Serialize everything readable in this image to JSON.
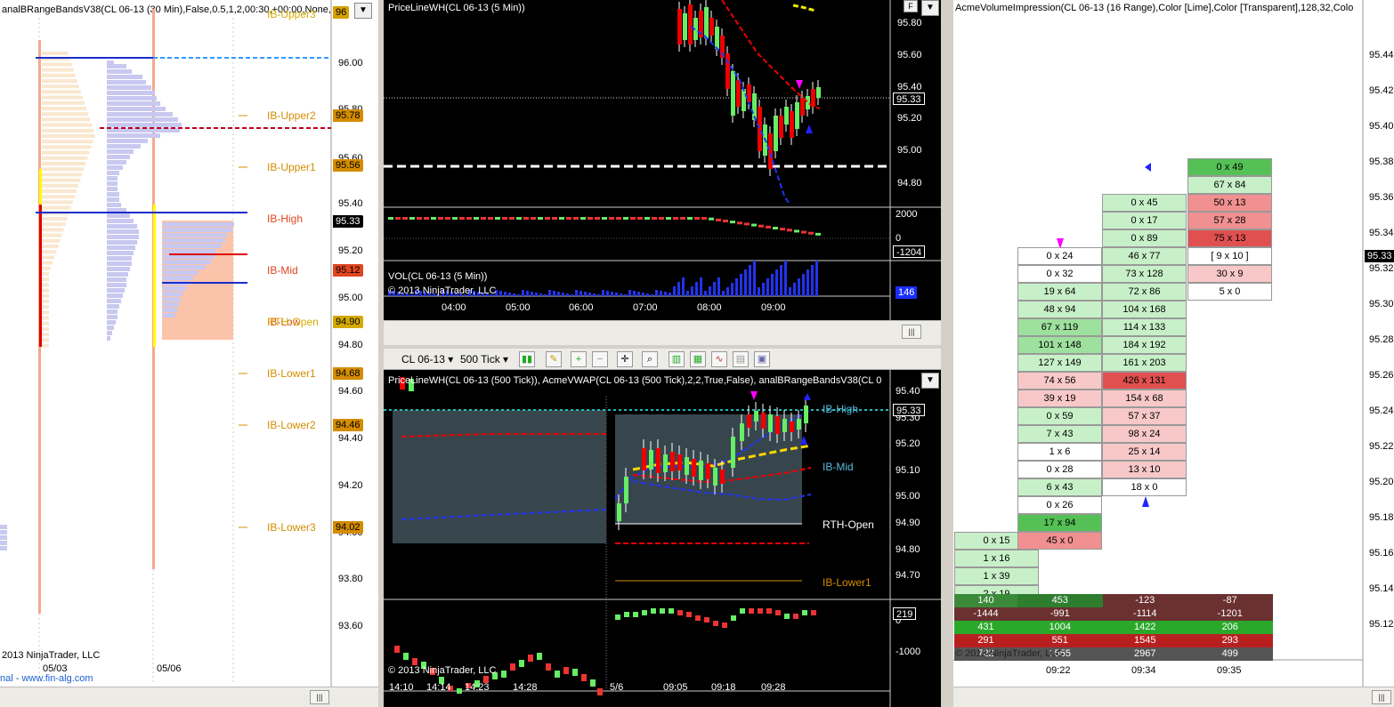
{
  "left_chart": {
    "title": "analBRangeBandsV38(CL 06-13 (30 Min),False,0.5,1,2,00:30,+00:00,None,A",
    "price_labels": [
      "96.00",
      "95.80",
      "95.60",
      "95.40",
      "95.20",
      "95.00",
      "94.80",
      "94.60",
      "94.40",
      "94.20",
      "94.00",
      "93.80",
      "93.60"
    ],
    "levels": [
      {
        "name": "IB-Upper3",
        "color": "#d4aa00"
      },
      {
        "name": "IB-Upper2",
        "color": "#d48c00"
      },
      {
        "name": "IB-Upper1",
        "color": "#d48c00"
      },
      {
        "name": "IB-High",
        "color": "#e0451e"
      },
      {
        "name": "IB-Mid",
        "color": "#e0451e"
      },
      {
        "name": "IB-Low",
        "color": "#e0451e"
      },
      {
        "name": "RTH-Open",
        "color": "#d4aa00"
      },
      {
        "name": "IB-Lower1",
        "color": "#d48c00"
      },
      {
        "name": "IB-Lower2",
        "color": "#d48c00"
      },
      {
        "name": "IB-Lower3",
        "color": "#d48c00"
      }
    ],
    "tags": [
      {
        "value": "96",
        "color": "#d4a000"
      },
      {
        "value": "95.78",
        "color": "#d48c00"
      },
      {
        "value": "95.56",
        "color": "#d48c00"
      },
      {
        "value": "95.33",
        "color": "#000000"
      },
      {
        "value": "95.12",
        "color": "#e0451e"
      },
      {
        "value": "94.90",
        "color": "#d4aa00"
      },
      {
        "value": "94.68",
        "color": "#d48c00"
      },
      {
        "value": "94.46",
        "color": "#d48c00"
      },
      {
        "value": "94.02",
        "color": "#d48c00"
      }
    ],
    "dates": [
      "05/03",
      "05/06"
    ],
    "copyright": "2013 NinjaTrader, LLC",
    "footer_link": "nal - www.fin-alg.com",
    "dd_btn": "▼"
  },
  "top_mid_chart": {
    "title": "PriceLineWH(CL 06-13 (5 Min))",
    "price_labels": [
      "95.80",
      "95.60",
      "95.40",
      "95.20",
      "95.00",
      "94.80"
    ],
    "last_price": "95.33",
    "vol_title": "VOL(CL 06-13 (5 Min))",
    "vol_labels": [
      "2000",
      "0"
    ],
    "vol_tag": "-1204",
    "vol_last": "146",
    "copyright": "© 2013 NinjaTrader, LLC",
    "times": [
      "04:00",
      "05:00",
      "06:00",
      "07:00",
      "08:00",
      "09:00"
    ],
    "f_btn": "F",
    "dd_btn": "▼",
    "scroll_btn": "|||"
  },
  "toolbar": {
    "instrument": "CL 06-13",
    "period": "500 Tick",
    "caret": "▾",
    "icons": [
      "candle-icon",
      "pencil-icon",
      "zoom-in-icon",
      "zoom-out-icon",
      "crosshair-icon",
      "magnify-icon",
      "chart-style-icon",
      "bar-style-icon",
      "indicator-icon",
      "strategy-icon",
      "properties-icon"
    ]
  },
  "bottom_mid_chart": {
    "title": "PriceLineWH(CL 06-13 (500 Tick)), AcmeVWAP(CL 06-13 (500 Tick),2,2,True,False), analBRangeBandsV38(CL 0",
    "price_labels": [
      "95.40",
      "95.30",
      "95.20",
      "95.10",
      "95.00",
      "94.90",
      "94.80",
      "94.70"
    ],
    "last_price": "95.33",
    "level_labels": [
      "IB-High",
      "IB-Mid",
      "RTH-Open",
      "IB-Lower1"
    ],
    "delta_labels": [
      "0",
      "-1000"
    ],
    "delta_tag": "219",
    "copyright": "© 2013 NinjaTrader, LLC",
    "times": [
      "14:10",
      "14:14",
      "14:23",
      "14:28",
      "5/6",
      "09:05",
      "09:18",
      "09:28"
    ],
    "dd_btn": "▼"
  },
  "right_chart": {
    "title": "AcmeVolumeImpression(CL 06-13 (16 Range),Color [Lime],Color [Transparent],128,32,Colo",
    "price_labels": [
      "95.44",
      "95.42",
      "95.40",
      "95.38",
      "95.36",
      "95.34",
      "95.32",
      "95.30",
      "95.28",
      "95.26",
      "95.24",
      "95.22",
      "95.20",
      "95.18",
      "95.16",
      "95.14",
      "95.12"
    ],
    "last_price": "95.33",
    "times": [
      "09:22",
      "09:34",
      "09:35"
    ],
    "copyright": "© 2013 NinjaTrader, LLC",
    "col0": [
      "0 x 15",
      "1 x 16",
      "1 x 39",
      "2 x 19"
    ],
    "col1": [
      "0 x 24",
      "0 x 32",
      "19 x 64",
      "48 x 94",
      "67 x 119",
      "101 x 148",
      "127 x 149",
      "74 x 56",
      "39 x 19",
      "0 x 59",
      "7 x 43",
      "1 x 6",
      "0 x 28",
      "6 x 43",
      "0 x 26",
      "17 x 94",
      "45 x 0"
    ],
    "col2": [
      "0 x 45",
      "0 x 17",
      "0 x 89",
      "46 x 77",
      "73 x 128",
      "72 x 86",
      "104 x 168",
      "114 x 133",
      "184 x 192",
      "161 x 203",
      "426 x 131",
      "154 x 68",
      "57 x 37",
      "98 x 24",
      "25 x 14",
      "13 x 10",
      "18 x 0"
    ],
    "col3": [
      "0 x 49",
      "67 x 84",
      "50 x 13",
      "57 x 28",
      "75 x 13",
      "[ 9 x 10 ]",
      "30 x 9",
      "5 x 0"
    ],
    "stats": [
      [
        "140",
        "453",
        "-123",
        "-87"
      ],
      [
        "-1444",
        "-991",
        "-1114",
        "-1201"
      ],
      [
        "431",
        "1004",
        "1422",
        "206"
      ],
      [
        "291",
        "551",
        "1545",
        "293"
      ],
      [
        "722",
        "1555",
        "2967",
        "499"
      ]
    ]
  }
}
